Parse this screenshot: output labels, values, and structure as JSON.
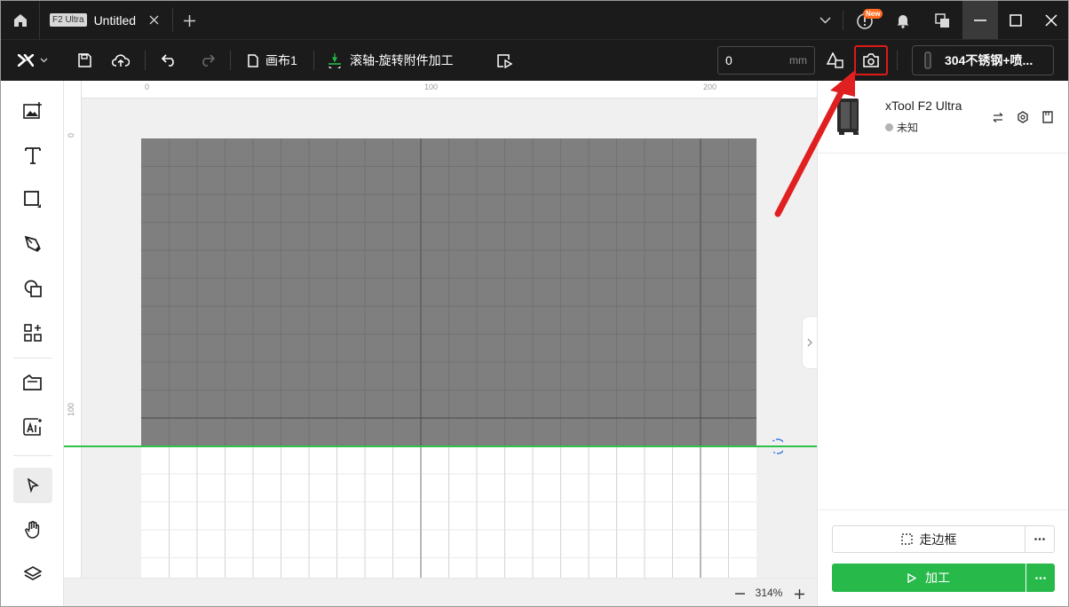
{
  "titlebar": {
    "tab_badge": "F2 Ultra",
    "tab_title": "Untitled",
    "new_badge": "New"
  },
  "toolbar": {
    "canvas_label": "画布1",
    "mode_label": "滚轴-旋转附件加工",
    "offset_value": "0",
    "offset_unit": "mm",
    "material_label": "304不锈钢+喷..."
  },
  "ruler": {
    "top_labels": [
      "0",
      "100",
      "200"
    ],
    "left_labels": [
      "0",
      "100"
    ]
  },
  "zoom": {
    "value": "314%"
  },
  "device": {
    "name": "xTool F2 Ultra",
    "status": "未知"
  },
  "actions": {
    "frame_label": "走边框",
    "process_label": "加工"
  },
  "colors": {
    "accent_green": "#27b94a",
    "highlight_red": "#e01919",
    "new_badge": "#ff6a1f",
    "dark_bg": "#1b1b1b"
  }
}
